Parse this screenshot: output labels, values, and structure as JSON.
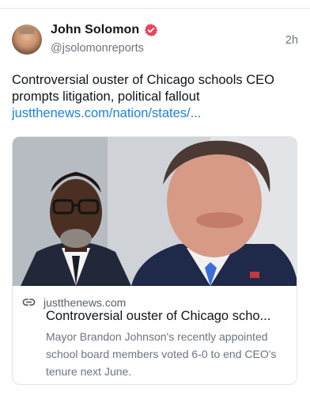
{
  "author": {
    "display_name": "John Solomon",
    "handle": "@jsolomonreports",
    "timestamp": "2h",
    "verified_badge_color": "#e8445a"
  },
  "post": {
    "text": "Controversial ouster of Chicago schools CEO prompts litigation, political fallout",
    "link_text": "justthenews.com/nation/states/..."
  },
  "link_card": {
    "domain": "justthenews.com",
    "title": "Controversial ouster of Chicago scho...",
    "description": "Mayor Brandon Johnson's recently appointed school board members voted 6-0 to end CEO's tenure next June."
  },
  "icons": {
    "verified": "verified-badge-icon",
    "link": "link-icon"
  },
  "colors": {
    "link": "#1d80d8",
    "secondary_text": "#6b7580"
  }
}
